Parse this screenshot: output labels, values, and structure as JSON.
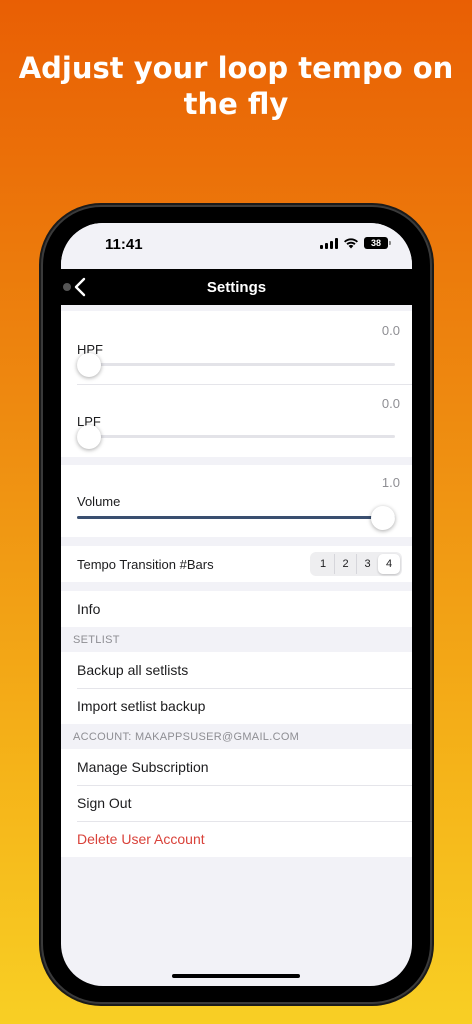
{
  "headline": {
    "line1": "Adjust your loop tempo on",
    "line2": "the fly"
  },
  "status_bar": {
    "time": "11:41",
    "battery": "38",
    "icons": [
      "signal-icon",
      "wifi-icon",
      "battery-icon"
    ]
  },
  "nav": {
    "title": "Settings",
    "back_icon": "chevron-left-icon"
  },
  "filters": {
    "hpf": {
      "label": "HPF",
      "value_text": "0.0",
      "level": 0.0
    },
    "lpf": {
      "label": "LPF",
      "value_text": "0.0",
      "level": 0.0
    }
  },
  "volume": {
    "label": "Volume",
    "value_text": "1.0",
    "level": 1.0
  },
  "tempo_transition": {
    "label": "Tempo Transition #Bars",
    "options": [
      "1",
      "2",
      "3",
      "4"
    ],
    "selected": "4"
  },
  "info": {
    "label": "Info"
  },
  "setlist": {
    "header": "SETLIST",
    "items": [
      "Backup all setlists",
      "Import setlist backup"
    ]
  },
  "account": {
    "header": "ACCOUNT: MAKAPPSUSER@GMAIL.COM",
    "items": [
      "Manage Subscription",
      "Sign Out"
    ],
    "delete_label": "Delete User Account"
  },
  "colors": {
    "accent_track": "#3a4f70",
    "danger": "#d9423a",
    "background_top": "#e95f04",
    "background_bottom": "#f8cf24"
  }
}
